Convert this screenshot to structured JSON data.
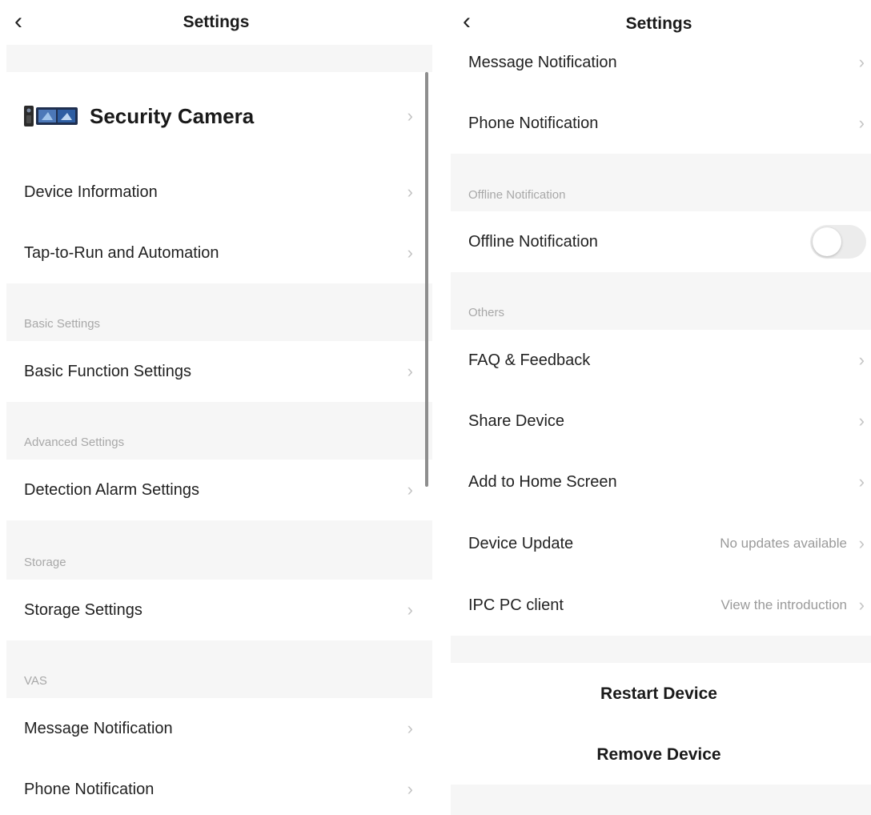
{
  "left": {
    "nav": {
      "back_glyph": "‹",
      "title": "Settings"
    },
    "device": {
      "name": "Security Camera",
      "icon": "security-camera-icon"
    },
    "rows": {
      "device_information": "Device Information",
      "tap_to_run": "Tap-to-Run and Automation",
      "basic_function_settings": "Basic Function Settings",
      "detection_alarm_settings": "Detection Alarm Settings",
      "storage_settings": "Storage Settings",
      "message_notification": "Message Notification",
      "phone_notification": "Phone Notification"
    },
    "sections": {
      "basic": "Basic Settings",
      "advanced": "Advanced Settings",
      "storage": "Storage",
      "vas": "VAS"
    }
  },
  "right": {
    "nav": {
      "back_glyph": "‹",
      "title": "Settings"
    },
    "rows": {
      "message_notification": "Message Notification",
      "phone_notification": "Phone Notification",
      "offline_notification": "Offline Notification",
      "faq_feedback": "FAQ & Feedback",
      "share_device": "Share Device",
      "add_home_screen": "Add to Home Screen",
      "device_update": "Device Update",
      "ipc_pc_client": "IPC PC client"
    },
    "values": {
      "device_update": "No updates available",
      "ipc_pc_client": "View the introduction"
    },
    "sections": {
      "offline": "Offline Notification",
      "others": "Others"
    },
    "toggle": {
      "offline_notification_on": false
    },
    "actions": {
      "restart": "Restart Device",
      "remove": "Remove Device"
    }
  },
  "chevron_glyph": "›",
  "colors": {
    "separator_bg": "#f6f6f6",
    "secondary_text": "#a8a8a8",
    "toggle_off": "#ececec"
  }
}
